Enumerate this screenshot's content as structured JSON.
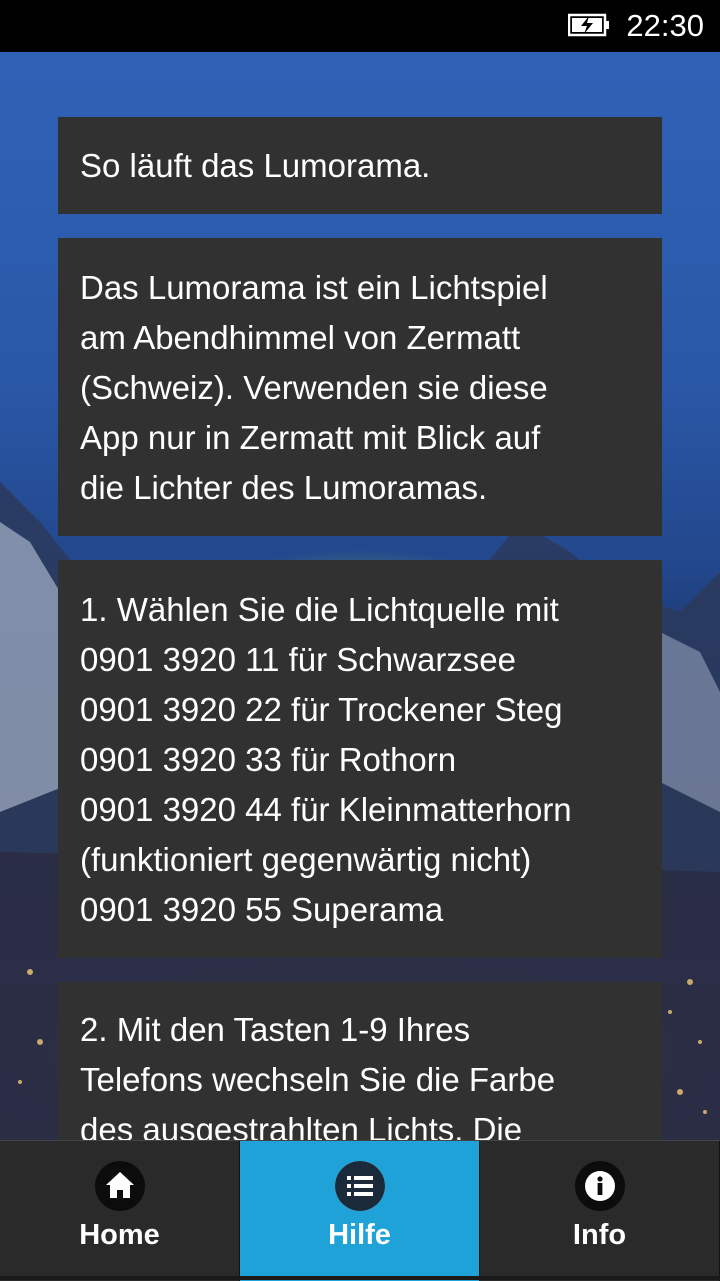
{
  "status": {
    "time": "22:30",
    "battery_icon": "battery-charging-icon"
  },
  "cards": [
    {
      "text": "So läuft das Lumorama."
    },
    {
      "text": "Das Lumorama ist ein Lichtspiel\nam Abendhimmel von Zermatt\n(Schweiz). Verwenden sie diese\nApp nur in Zermatt mit Blick auf\ndie Lichter des Lumoramas."
    },
    {
      "text": "1. Wählen Sie die Lichtquelle mit\n0901 3920 11 für Schwarzsee\n0901 3920 22 für Trockener Steg\n0901 3920 33 für Rothorn\n0901 3920 44 für Kleinmatterhorn\n(funktioniert gegenwärtig nicht)\n0901 3920 55 Superama"
    },
    {
      "text": "2. Mit den Tasten 1-9 Ihres\nTelefons wechseln Sie die Farbe\ndes ausgestrahlten Lichts. Die"
    }
  ],
  "nav": {
    "items": [
      {
        "label": "Home",
        "icon": "home-icon"
      },
      {
        "label": "Hilfe",
        "icon": "list-icon"
      },
      {
        "label": "Info",
        "icon": "info-icon"
      }
    ],
    "active": "Hilfe",
    "active_color": "#1ea2d8"
  }
}
